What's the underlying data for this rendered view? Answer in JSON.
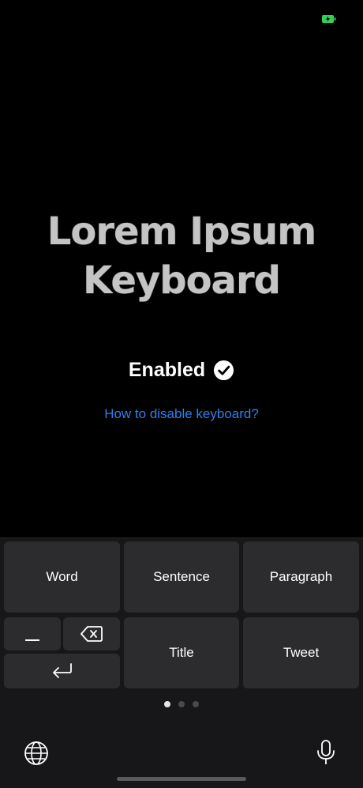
{
  "status_bar": {
    "battery_icon": "battery-charging-icon",
    "battery_color": "#30d158"
  },
  "hero": {
    "title_line1": "Lorem Ipsum",
    "title_line2": "Keyboard"
  },
  "status": {
    "text": "Enabled",
    "icon": "checkmark-circle-icon"
  },
  "link": {
    "text": "How to disable keyboard?",
    "color": "#2f80ed"
  },
  "keyboard": {
    "keys": {
      "word": "Word",
      "sentence": "Sentence",
      "paragraph": "Paragraph",
      "title": "Title",
      "tweet": "Tweet"
    },
    "icons": [
      "underscore-icon",
      "delete-icon",
      "return-icon",
      "globe-icon",
      "microphone-icon"
    ],
    "pages": {
      "count": 3,
      "active": 1
    }
  }
}
